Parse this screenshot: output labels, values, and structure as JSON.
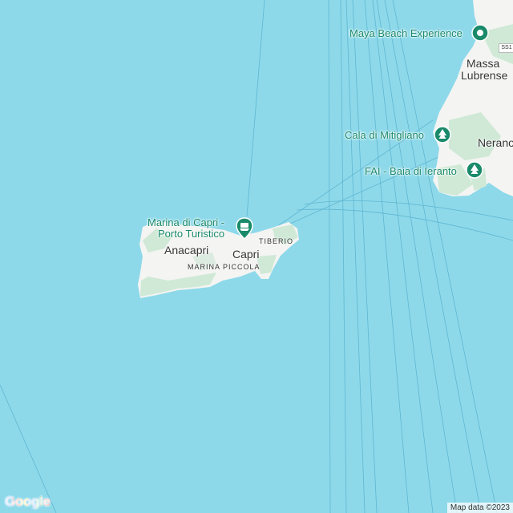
{
  "map": {
    "colors": {
      "water": "#8dd9ea",
      "land": "#f4f4f2",
      "green": "#cfe9d6",
      "poi": "#1a8a6a",
      "route": "#5fb6d0"
    },
    "labels": {
      "maya_beach": "Maya Beach Experience",
      "massa": "Massa",
      "lubrense": "Lubrense",
      "cala_mitigliano": "Cala di Mitigliano",
      "nerano": "Nerano",
      "fai_ieranto": "FAI - Baia di Ieranto",
      "marina_capri_1": "Marina di Capri -",
      "marina_capri_2": "Porto Turistico",
      "anacapri": "Anacapri",
      "capri": "Capri",
      "tiberio": "TIBERIO",
      "marina_piccola": "MARINA PICCOLA",
      "road_shield": "SS1"
    },
    "icons": {
      "maya_beach": "beach-pin-icon",
      "cala_mitigliano": "park-pin-icon",
      "fai_ieranto": "park-pin-icon",
      "marina_capri": "ferry-pin-icon"
    }
  },
  "footer": {
    "google_logo": "Google",
    "attribution": "Map data ©2023"
  }
}
